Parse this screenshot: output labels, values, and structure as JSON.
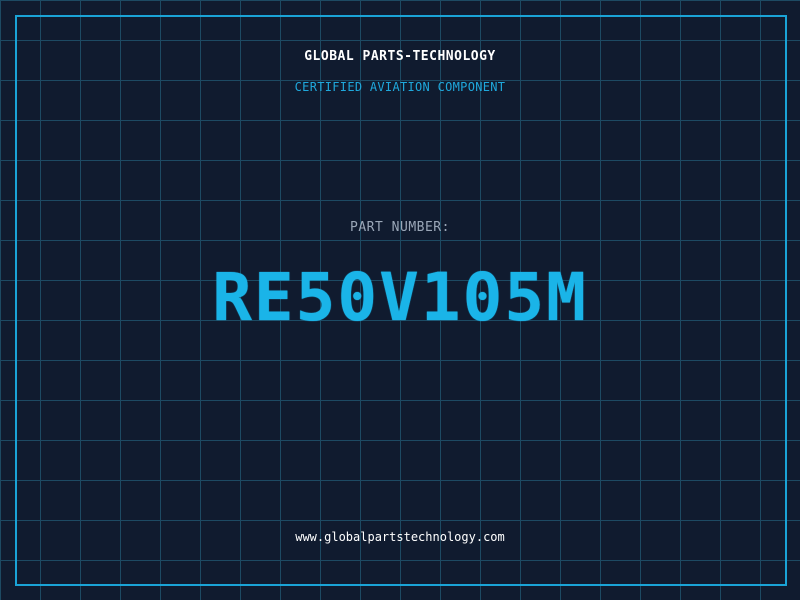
{
  "brand": {
    "name": "GLOBAL PARTS-TECHNOLOGY",
    "tagline": "CERTIFIED AVIATION COMPONENT"
  },
  "part": {
    "label": "PART NUMBER:",
    "number": "RE50V105M"
  },
  "footer": {
    "website": "www.globalpartstechnology.com"
  },
  "colors": {
    "background": "#101b2f",
    "grid": "#1d4a63",
    "accent": "#1ab4e8",
    "text": "#ffffff",
    "muted": "#9ba7b8"
  }
}
